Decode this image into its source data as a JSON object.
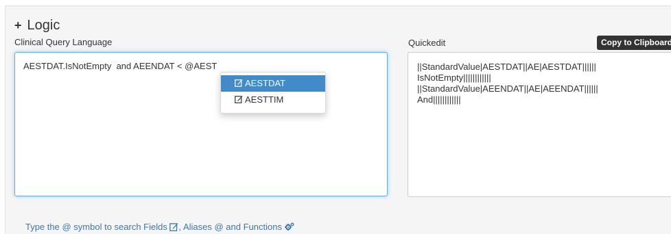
{
  "logic": {
    "toggle": "+",
    "title": "Logic"
  },
  "cql": {
    "label": "Clinical Query Language",
    "query": "AESTDAT.IsNotEmpty  and AEENDAT < @AEST"
  },
  "autocomplete": {
    "items": [
      {
        "label": "AESTDAT",
        "icon": "edit-icon",
        "selected": true
      },
      {
        "label": "AESTTIM",
        "icon": "edit-icon",
        "selected": false
      }
    ]
  },
  "quickedit": {
    "label": "Quickedit",
    "copy_button": "Copy to Clipboard",
    "lines": [
      "||StandardValue|AESTDAT||AE|AESTDAT||||||",
      "IsNotEmpty||||||||||||",
      "||StandardValue|AEENDAT||AE|AEENDAT||||||",
      "And||||||||||||"
    ]
  },
  "hint": {
    "part1": "Type the @ symbol to search Fields ",
    "part2": ", Aliases @ and Functions ",
    "icons": [
      "edit-icon",
      "cogs-icon"
    ]
  },
  "colors": {
    "accent": "#337ab7",
    "selected_bg": "#428bca",
    "focus_border": "#66afe9",
    "button_bg": "#333333"
  }
}
